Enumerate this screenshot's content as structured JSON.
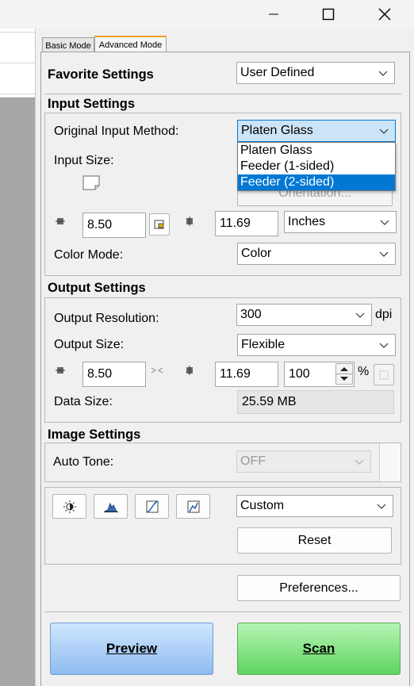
{
  "tabs": {
    "basic": "Basic Mode",
    "advanced": "Advanced Mode"
  },
  "favorite": {
    "label": "Favorite Settings",
    "value": "User Defined"
  },
  "input": {
    "header": "Input Settings",
    "method_label": "Original Input Method:",
    "method_value": "Platen Glass",
    "method_options": [
      "Platen Glass",
      "Feeder (1-sided)",
      "Feeder (2-sided)"
    ],
    "method_highlighted": "Feeder (2-sided)",
    "size_label": "Input Size:",
    "orientation_label": "Orientation...",
    "width": "8.50",
    "height": "11.69",
    "unit": "Inches",
    "color_label": "Color Mode:",
    "color_value": "Color"
  },
  "output": {
    "header": "Output Settings",
    "resolution_label": "Output Resolution:",
    "resolution_value": "300",
    "resolution_unit": "dpi",
    "size_label": "Output Size:",
    "size_value": "Flexible",
    "width": "8.50",
    "height": "11.69",
    "scale": "100",
    "scale_unit": "%",
    "data_size_label": "Data Size:",
    "data_size_value": "25.59 MB"
  },
  "image": {
    "header": "Image Settings",
    "auto_tone_label": "Auto Tone:",
    "auto_tone_value": "OFF",
    "preset_value": "Custom",
    "reset_label": "Reset"
  },
  "preferences_label": "Preferences...",
  "preview_label": "Preview",
  "scan_label": "Scan",
  "colors": {
    "accent": "#0078d4",
    "preview_bg": "#a8cdf5",
    "scan_bg": "#7ee37e",
    "tab_accent": "#f0a020"
  }
}
